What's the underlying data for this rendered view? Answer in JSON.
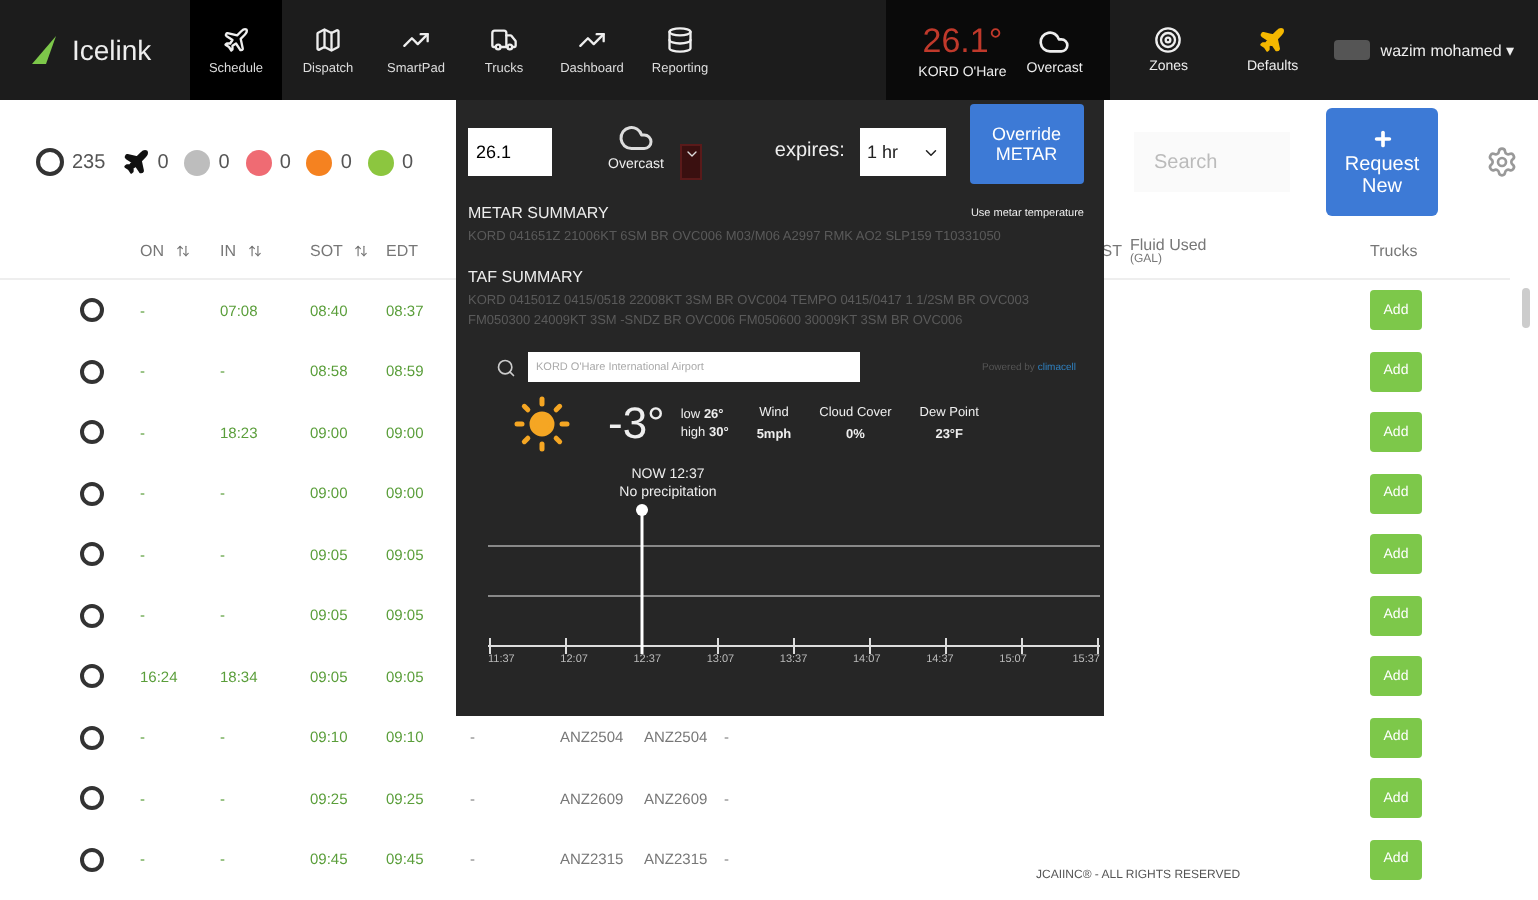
{
  "nav": {
    "logo": "Icelink",
    "items": [
      {
        "label": "Schedule",
        "selected": true
      },
      {
        "label": "Dispatch",
        "selected": false
      },
      {
        "label": "SmartPad",
        "selected": false
      },
      {
        "label": "Trucks",
        "selected": false
      },
      {
        "label": "Dashboard",
        "selected": false
      },
      {
        "label": "Reporting",
        "selected": false
      }
    ],
    "weather": {
      "temp": "26.1°",
      "station": "KORD O'Hare",
      "condition": "Overcast"
    },
    "right": [
      {
        "label": "Zones"
      },
      {
        "label": "Defaults"
      }
    ],
    "user": "wazim mohamed",
    "user_caret": "▾"
  },
  "counters": [
    {
      "kind": "ring",
      "count": "235"
    },
    {
      "kind": "plane",
      "count": "0"
    },
    {
      "kind": "dot",
      "color": "#bdbdbd",
      "count": "0"
    },
    {
      "kind": "dot",
      "color": "#ef6b73",
      "count": "0"
    },
    {
      "kind": "dot",
      "color": "#f58220",
      "count": "0"
    },
    {
      "kind": "dot",
      "color": "#8cc63f",
      "count": "0"
    }
  ],
  "search": {
    "placeholder": "Search"
  },
  "request_button": "Request New",
  "table": {
    "columns": [
      "ON",
      "IN",
      "SOT",
      "EDT"
    ],
    "column_cut": "ST",
    "fluid": "Fluid Used",
    "fluid_unit": "(GAL)",
    "trucks": "Trucks",
    "rows": [
      {
        "on": "-",
        "in": "07:08",
        "sot": "08:40",
        "edt": "08:37",
        "add": "Add"
      },
      {
        "on": "-",
        "in": "-",
        "sot": "08:58",
        "edt": "08:59",
        "add": "Add"
      },
      {
        "on": "-",
        "in": "18:23",
        "sot": "09:00",
        "edt": "09:00",
        "add": "Add"
      },
      {
        "on": "-",
        "in": "-",
        "sot": "09:00",
        "edt": "09:00",
        "add": "Add"
      },
      {
        "on": "-",
        "in": "-",
        "sot": "09:05",
        "edt": "09:05",
        "add": "Add"
      },
      {
        "on": "-",
        "in": "-",
        "sot": "09:05",
        "edt": "09:05",
        "add": "Add"
      },
      {
        "on": "16:24",
        "in": "18:34",
        "sot": "09:05",
        "edt": "09:05",
        "add": "Add"
      },
      {
        "on": "-",
        "in": "-",
        "sot": "09:10",
        "edt": "09:10",
        "gap": "-",
        "flight_a": "ANZ2504",
        "flight_b": "ANZ2504",
        "status": "-",
        "add": "Add"
      },
      {
        "on": "-",
        "in": "-",
        "sot": "09:25",
        "edt": "09:25",
        "gap": "-",
        "flight_a": "ANZ2609",
        "flight_b": "ANZ2609",
        "status": "-",
        "add": "Add"
      },
      {
        "on": "-",
        "in": "-",
        "sot": "09:45",
        "edt": "09:45",
        "gap": "-",
        "flight_a": "ANZ2315",
        "flight_b": "ANZ2315",
        "status": "-",
        "add": "Add"
      }
    ]
  },
  "footer": "JCAIINC® - ALL RIGHTS RESERVED",
  "popup": {
    "temp_value": "26.1",
    "condition": "Overcast",
    "expires_label": "expires:",
    "expires_value": "1 hr",
    "override_button": "Override METAR",
    "metar_title": "METAR SUMMARY",
    "metar_link": "Use metar temperature",
    "metar": "KORD 041651Z 21006KT 6SM BR OVC006 M03/M06 A2997 RMK AO2 SLP159 T10331050",
    "taf_title": "TAF SUMMARY",
    "taf": "KORD 041501Z 0415/0518 22008KT 3SM BR OVC004 TEMPO 0415/0417 1 1/2SM BR OVC003 FM050300 24009KT 3SM -SNDZ BR OVC006 FM050600 30009KT 3SM BR OVC006",
    "airport": "KORD O'Hare International Airport",
    "powered": "Powered by",
    "brand": "climacell",
    "now_temp": "-3°",
    "low_label": "low",
    "low": "26°",
    "high_label": "high",
    "high": "30°",
    "stats": [
      {
        "label": "Wind",
        "value": "5mph"
      },
      {
        "label": "Cloud Cover",
        "value": "0%"
      },
      {
        "label": "Dew Point",
        "value": "23°F"
      }
    ],
    "now_label": "NOW 12:37",
    "precip": "No precipitation",
    "ticks": [
      "11:37",
      "12:07",
      "12:37",
      "13:07",
      "13:37",
      "14:07",
      "14:37",
      "15:07",
      "15:37"
    ]
  }
}
